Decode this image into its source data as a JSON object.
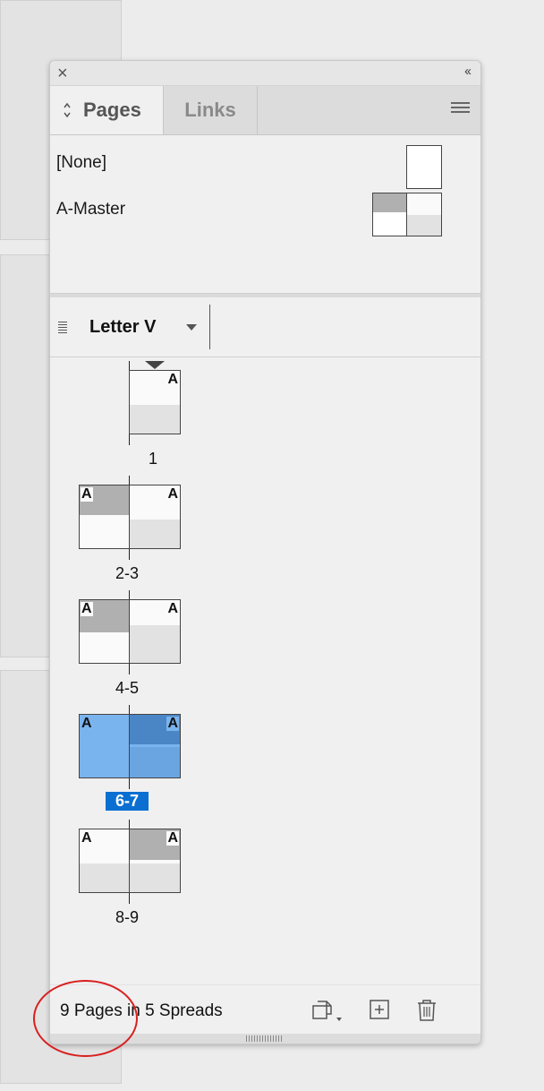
{
  "panel": {
    "close_glyph": "×",
    "collapse_glyph": "‹‹",
    "tabs": [
      {
        "label": "Pages",
        "active": true
      },
      {
        "label": "Links",
        "active": false
      }
    ]
  },
  "masters": [
    {
      "label": "[None]"
    },
    {
      "label": "A-Master"
    }
  ],
  "page_size": {
    "label": "Letter V"
  },
  "spreads": [
    {
      "label": "1",
      "pages": [
        {
          "prefix": "A"
        }
      ],
      "selected": false
    },
    {
      "label": "2-3",
      "pages": [
        {
          "prefix": "A"
        },
        {
          "prefix": "A"
        }
      ],
      "selected": false
    },
    {
      "label": "4-5",
      "pages": [
        {
          "prefix": "A"
        },
        {
          "prefix": "A"
        }
      ],
      "selected": false
    },
    {
      "label": "6-7",
      "pages": [
        {
          "prefix": "A"
        },
        {
          "prefix": "A"
        }
      ],
      "selected": true
    },
    {
      "label": "8-9",
      "pages": [
        {
          "prefix": "A"
        },
        {
          "prefix": "A"
        }
      ],
      "selected": false
    }
  ],
  "footer": {
    "status": "9 Pages in 5 Spreads"
  },
  "colors": {
    "selection": "#0a6fd1",
    "annotation": "#d8201f"
  }
}
